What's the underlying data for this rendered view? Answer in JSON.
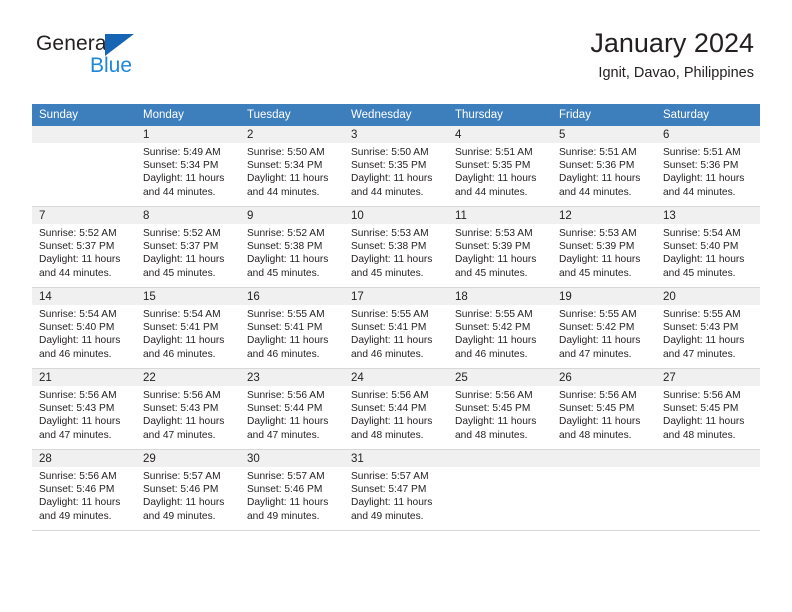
{
  "brand": {
    "word1": "General",
    "word2": "Blue",
    "triangle_color": "#1665b4",
    "blue_color": "#1f86d8"
  },
  "header": {
    "title": "January 2024",
    "location": "Ignit, Davao, Philippines"
  },
  "theme": {
    "header_row_bg": "#3d7ebd",
    "daynum_bg": "#f0f0f0",
    "grid_line": "#d8d8d8",
    "text": "#231f20"
  },
  "weekday_headers": [
    "Sunday",
    "Monday",
    "Tuesday",
    "Wednesday",
    "Thursday",
    "Friday",
    "Saturday"
  ],
  "labels": {
    "sunrise_prefix": "Sunrise:",
    "sunset_prefix": "Sunset:",
    "daylight_prefix": "Daylight:"
  },
  "weeks": [
    [
      {
        "day": "",
        "sunrise": "",
        "sunset": "",
        "daylight_line1": "",
        "daylight_line2": ""
      },
      {
        "day": "1",
        "sunrise": "Sunrise: 5:49 AM",
        "sunset": "Sunset: 5:34 PM",
        "daylight_line1": "Daylight: 11 hours",
        "daylight_line2": "and 44 minutes."
      },
      {
        "day": "2",
        "sunrise": "Sunrise: 5:50 AM",
        "sunset": "Sunset: 5:34 PM",
        "daylight_line1": "Daylight: 11 hours",
        "daylight_line2": "and 44 minutes."
      },
      {
        "day": "3",
        "sunrise": "Sunrise: 5:50 AM",
        "sunset": "Sunset: 5:35 PM",
        "daylight_line1": "Daylight: 11 hours",
        "daylight_line2": "and 44 minutes."
      },
      {
        "day": "4",
        "sunrise": "Sunrise: 5:51 AM",
        "sunset": "Sunset: 5:35 PM",
        "daylight_line1": "Daylight: 11 hours",
        "daylight_line2": "and 44 minutes."
      },
      {
        "day": "5",
        "sunrise": "Sunrise: 5:51 AM",
        "sunset": "Sunset: 5:36 PM",
        "daylight_line1": "Daylight: 11 hours",
        "daylight_line2": "and 44 minutes."
      },
      {
        "day": "6",
        "sunrise": "Sunrise: 5:51 AM",
        "sunset": "Sunset: 5:36 PM",
        "daylight_line1": "Daylight: 11 hours",
        "daylight_line2": "and 44 minutes."
      }
    ],
    [
      {
        "day": "7",
        "sunrise": "Sunrise: 5:52 AM",
        "sunset": "Sunset: 5:37 PM",
        "daylight_line1": "Daylight: 11 hours",
        "daylight_line2": "and 44 minutes."
      },
      {
        "day": "8",
        "sunrise": "Sunrise: 5:52 AM",
        "sunset": "Sunset: 5:37 PM",
        "daylight_line1": "Daylight: 11 hours",
        "daylight_line2": "and 45 minutes."
      },
      {
        "day": "9",
        "sunrise": "Sunrise: 5:52 AM",
        "sunset": "Sunset: 5:38 PM",
        "daylight_line1": "Daylight: 11 hours",
        "daylight_line2": "and 45 minutes."
      },
      {
        "day": "10",
        "sunrise": "Sunrise: 5:53 AM",
        "sunset": "Sunset: 5:38 PM",
        "daylight_line1": "Daylight: 11 hours",
        "daylight_line2": "and 45 minutes."
      },
      {
        "day": "11",
        "sunrise": "Sunrise: 5:53 AM",
        "sunset": "Sunset: 5:39 PM",
        "daylight_line1": "Daylight: 11 hours",
        "daylight_line2": "and 45 minutes."
      },
      {
        "day": "12",
        "sunrise": "Sunrise: 5:53 AM",
        "sunset": "Sunset: 5:39 PM",
        "daylight_line1": "Daylight: 11 hours",
        "daylight_line2": "and 45 minutes."
      },
      {
        "day": "13",
        "sunrise": "Sunrise: 5:54 AM",
        "sunset": "Sunset: 5:40 PM",
        "daylight_line1": "Daylight: 11 hours",
        "daylight_line2": "and 45 minutes."
      }
    ],
    [
      {
        "day": "14",
        "sunrise": "Sunrise: 5:54 AM",
        "sunset": "Sunset: 5:40 PM",
        "daylight_line1": "Daylight: 11 hours",
        "daylight_line2": "and 46 minutes."
      },
      {
        "day": "15",
        "sunrise": "Sunrise: 5:54 AM",
        "sunset": "Sunset: 5:41 PM",
        "daylight_line1": "Daylight: 11 hours",
        "daylight_line2": "and 46 minutes."
      },
      {
        "day": "16",
        "sunrise": "Sunrise: 5:55 AM",
        "sunset": "Sunset: 5:41 PM",
        "daylight_line1": "Daylight: 11 hours",
        "daylight_line2": "and 46 minutes."
      },
      {
        "day": "17",
        "sunrise": "Sunrise: 5:55 AM",
        "sunset": "Sunset: 5:41 PM",
        "daylight_line1": "Daylight: 11 hours",
        "daylight_line2": "and 46 minutes."
      },
      {
        "day": "18",
        "sunrise": "Sunrise: 5:55 AM",
        "sunset": "Sunset: 5:42 PM",
        "daylight_line1": "Daylight: 11 hours",
        "daylight_line2": "and 46 minutes."
      },
      {
        "day": "19",
        "sunrise": "Sunrise: 5:55 AM",
        "sunset": "Sunset: 5:42 PM",
        "daylight_line1": "Daylight: 11 hours",
        "daylight_line2": "and 47 minutes."
      },
      {
        "day": "20",
        "sunrise": "Sunrise: 5:55 AM",
        "sunset": "Sunset: 5:43 PM",
        "daylight_line1": "Daylight: 11 hours",
        "daylight_line2": "and 47 minutes."
      }
    ],
    [
      {
        "day": "21",
        "sunrise": "Sunrise: 5:56 AM",
        "sunset": "Sunset: 5:43 PM",
        "daylight_line1": "Daylight: 11 hours",
        "daylight_line2": "and 47 minutes."
      },
      {
        "day": "22",
        "sunrise": "Sunrise: 5:56 AM",
        "sunset": "Sunset: 5:43 PM",
        "daylight_line1": "Daylight: 11 hours",
        "daylight_line2": "and 47 minutes."
      },
      {
        "day": "23",
        "sunrise": "Sunrise: 5:56 AM",
        "sunset": "Sunset: 5:44 PM",
        "daylight_line1": "Daylight: 11 hours",
        "daylight_line2": "and 47 minutes."
      },
      {
        "day": "24",
        "sunrise": "Sunrise: 5:56 AM",
        "sunset": "Sunset: 5:44 PM",
        "daylight_line1": "Daylight: 11 hours",
        "daylight_line2": "and 48 minutes."
      },
      {
        "day": "25",
        "sunrise": "Sunrise: 5:56 AM",
        "sunset": "Sunset: 5:45 PM",
        "daylight_line1": "Daylight: 11 hours",
        "daylight_line2": "and 48 minutes."
      },
      {
        "day": "26",
        "sunrise": "Sunrise: 5:56 AM",
        "sunset": "Sunset: 5:45 PM",
        "daylight_line1": "Daylight: 11 hours",
        "daylight_line2": "and 48 minutes."
      },
      {
        "day": "27",
        "sunrise": "Sunrise: 5:56 AM",
        "sunset": "Sunset: 5:45 PM",
        "daylight_line1": "Daylight: 11 hours",
        "daylight_line2": "and 48 minutes."
      }
    ],
    [
      {
        "day": "28",
        "sunrise": "Sunrise: 5:56 AM",
        "sunset": "Sunset: 5:46 PM",
        "daylight_line1": "Daylight: 11 hours",
        "daylight_line2": "and 49 minutes."
      },
      {
        "day": "29",
        "sunrise": "Sunrise: 5:57 AM",
        "sunset": "Sunset: 5:46 PM",
        "daylight_line1": "Daylight: 11 hours",
        "daylight_line2": "and 49 minutes."
      },
      {
        "day": "30",
        "sunrise": "Sunrise: 5:57 AM",
        "sunset": "Sunset: 5:46 PM",
        "daylight_line1": "Daylight: 11 hours",
        "daylight_line2": "and 49 minutes."
      },
      {
        "day": "31",
        "sunrise": "Sunrise: 5:57 AM",
        "sunset": "Sunset: 5:47 PM",
        "daylight_line1": "Daylight: 11 hours",
        "daylight_line2": "and 49 minutes."
      },
      {
        "day": "",
        "sunrise": "",
        "sunset": "",
        "daylight_line1": "",
        "daylight_line2": ""
      },
      {
        "day": "",
        "sunrise": "",
        "sunset": "",
        "daylight_line1": "",
        "daylight_line2": ""
      },
      {
        "day": "",
        "sunrise": "",
        "sunset": "",
        "daylight_line1": "",
        "daylight_line2": ""
      }
    ]
  ]
}
